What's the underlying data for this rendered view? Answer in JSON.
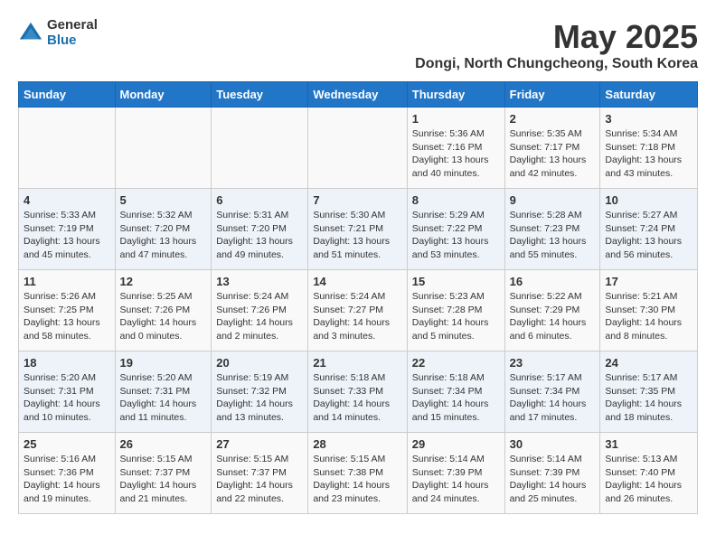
{
  "logo": {
    "general": "General",
    "blue": "Blue"
  },
  "title": "May 2025",
  "location": "Dongi, North Chungcheong, South Korea",
  "weekdays": [
    "Sunday",
    "Monday",
    "Tuesday",
    "Wednesday",
    "Thursday",
    "Friday",
    "Saturday"
  ],
  "weeks": [
    [
      {
        "day": "",
        "info": ""
      },
      {
        "day": "",
        "info": ""
      },
      {
        "day": "",
        "info": ""
      },
      {
        "day": "",
        "info": ""
      },
      {
        "day": "1",
        "info": "Sunrise: 5:36 AM\nSunset: 7:16 PM\nDaylight: 13 hours\nand 40 minutes."
      },
      {
        "day": "2",
        "info": "Sunrise: 5:35 AM\nSunset: 7:17 PM\nDaylight: 13 hours\nand 42 minutes."
      },
      {
        "day": "3",
        "info": "Sunrise: 5:34 AM\nSunset: 7:18 PM\nDaylight: 13 hours\nand 43 minutes."
      }
    ],
    [
      {
        "day": "4",
        "info": "Sunrise: 5:33 AM\nSunset: 7:19 PM\nDaylight: 13 hours\nand 45 minutes."
      },
      {
        "day": "5",
        "info": "Sunrise: 5:32 AM\nSunset: 7:20 PM\nDaylight: 13 hours\nand 47 minutes."
      },
      {
        "day": "6",
        "info": "Sunrise: 5:31 AM\nSunset: 7:20 PM\nDaylight: 13 hours\nand 49 minutes."
      },
      {
        "day": "7",
        "info": "Sunrise: 5:30 AM\nSunset: 7:21 PM\nDaylight: 13 hours\nand 51 minutes."
      },
      {
        "day": "8",
        "info": "Sunrise: 5:29 AM\nSunset: 7:22 PM\nDaylight: 13 hours\nand 53 minutes."
      },
      {
        "day": "9",
        "info": "Sunrise: 5:28 AM\nSunset: 7:23 PM\nDaylight: 13 hours\nand 55 minutes."
      },
      {
        "day": "10",
        "info": "Sunrise: 5:27 AM\nSunset: 7:24 PM\nDaylight: 13 hours\nand 56 minutes."
      }
    ],
    [
      {
        "day": "11",
        "info": "Sunrise: 5:26 AM\nSunset: 7:25 PM\nDaylight: 13 hours\nand 58 minutes."
      },
      {
        "day": "12",
        "info": "Sunrise: 5:25 AM\nSunset: 7:26 PM\nDaylight: 14 hours\nand 0 minutes."
      },
      {
        "day": "13",
        "info": "Sunrise: 5:24 AM\nSunset: 7:26 PM\nDaylight: 14 hours\nand 2 minutes."
      },
      {
        "day": "14",
        "info": "Sunrise: 5:24 AM\nSunset: 7:27 PM\nDaylight: 14 hours\nand 3 minutes."
      },
      {
        "day": "15",
        "info": "Sunrise: 5:23 AM\nSunset: 7:28 PM\nDaylight: 14 hours\nand 5 minutes."
      },
      {
        "day": "16",
        "info": "Sunrise: 5:22 AM\nSunset: 7:29 PM\nDaylight: 14 hours\nand 6 minutes."
      },
      {
        "day": "17",
        "info": "Sunrise: 5:21 AM\nSunset: 7:30 PM\nDaylight: 14 hours\nand 8 minutes."
      }
    ],
    [
      {
        "day": "18",
        "info": "Sunrise: 5:20 AM\nSunset: 7:31 PM\nDaylight: 14 hours\nand 10 minutes."
      },
      {
        "day": "19",
        "info": "Sunrise: 5:20 AM\nSunset: 7:31 PM\nDaylight: 14 hours\nand 11 minutes."
      },
      {
        "day": "20",
        "info": "Sunrise: 5:19 AM\nSunset: 7:32 PM\nDaylight: 14 hours\nand 13 minutes."
      },
      {
        "day": "21",
        "info": "Sunrise: 5:18 AM\nSunset: 7:33 PM\nDaylight: 14 hours\nand 14 minutes."
      },
      {
        "day": "22",
        "info": "Sunrise: 5:18 AM\nSunset: 7:34 PM\nDaylight: 14 hours\nand 15 minutes."
      },
      {
        "day": "23",
        "info": "Sunrise: 5:17 AM\nSunset: 7:34 PM\nDaylight: 14 hours\nand 17 minutes."
      },
      {
        "day": "24",
        "info": "Sunrise: 5:17 AM\nSunset: 7:35 PM\nDaylight: 14 hours\nand 18 minutes."
      }
    ],
    [
      {
        "day": "25",
        "info": "Sunrise: 5:16 AM\nSunset: 7:36 PM\nDaylight: 14 hours\nand 19 minutes."
      },
      {
        "day": "26",
        "info": "Sunrise: 5:15 AM\nSunset: 7:37 PM\nDaylight: 14 hours\nand 21 minutes."
      },
      {
        "day": "27",
        "info": "Sunrise: 5:15 AM\nSunset: 7:37 PM\nDaylight: 14 hours\nand 22 minutes."
      },
      {
        "day": "28",
        "info": "Sunrise: 5:15 AM\nSunset: 7:38 PM\nDaylight: 14 hours\nand 23 minutes."
      },
      {
        "day": "29",
        "info": "Sunrise: 5:14 AM\nSunset: 7:39 PM\nDaylight: 14 hours\nand 24 minutes."
      },
      {
        "day": "30",
        "info": "Sunrise: 5:14 AM\nSunset: 7:39 PM\nDaylight: 14 hours\nand 25 minutes."
      },
      {
        "day": "31",
        "info": "Sunrise: 5:13 AM\nSunset: 7:40 PM\nDaylight: 14 hours\nand 26 minutes."
      }
    ]
  ]
}
